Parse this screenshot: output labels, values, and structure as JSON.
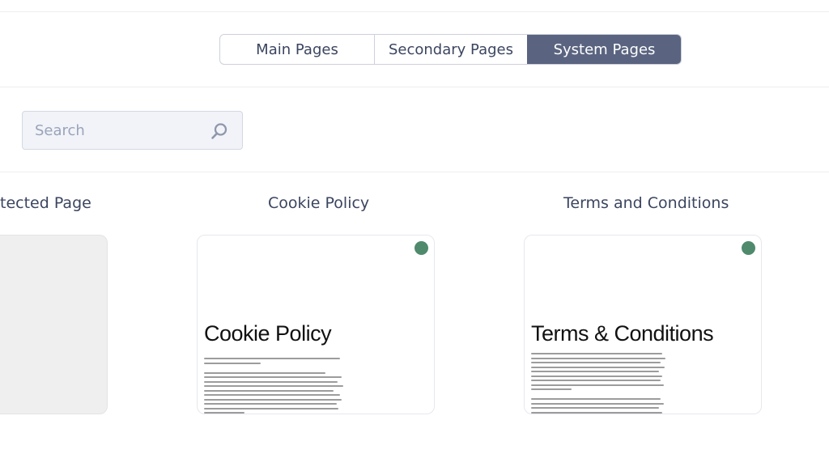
{
  "tabs": [
    {
      "label": "Main Pages",
      "active": false
    },
    {
      "label": "Secondary Pages",
      "active": false
    },
    {
      "label": "System Pages",
      "active": true
    }
  ],
  "search": {
    "placeholder": "Search",
    "value": "",
    "icon": "search-icon"
  },
  "cards": [
    {
      "title": "tected Page",
      "preview": "blank"
    },
    {
      "title": "Cookie Policy",
      "preview_heading": "Cookie Policy",
      "status_color": "#4f8a6c"
    },
    {
      "title": "Terms and Conditions",
      "preview_heading": "Terms & Conditions",
      "status_color": "#4f8a6c"
    }
  ],
  "colors": {
    "accent": "#5a6480",
    "text": "#3b4560",
    "status": "#4f8a6c"
  }
}
